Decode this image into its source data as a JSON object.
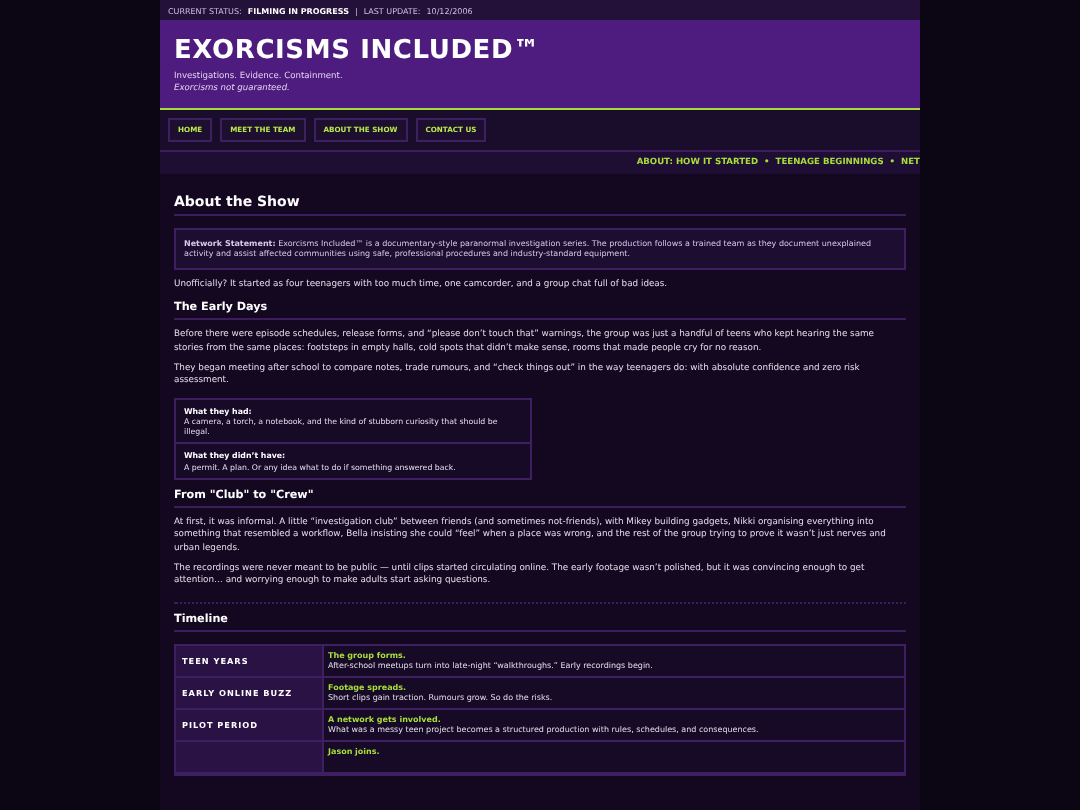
{
  "status_bar": {
    "status_label": "CURRENT STATUS:",
    "status_value": "FILMING IN PROGRESS",
    "separator": "|",
    "update_label": "LAST UPDATE:",
    "update_value": "10/12/2006"
  },
  "header": {
    "title": "EXORCISMS INCLUDED™",
    "tagline": "Investigations. Evidence. Containment.",
    "subtagline": "Exorcisms not guaranteed."
  },
  "nav": [
    {
      "label": "HOME"
    },
    {
      "label": "MEET THE TEAM"
    },
    {
      "label": "ABOUT THE SHOW"
    },
    {
      "label": "CONTACT US"
    }
  ],
  "ticker": "ABOUT: HOW IT STARTED  •  TEENAGE BEGINNINGS  •  NET",
  "content": [
    {
      "kind": "heading",
      "text": "About the Show"
    },
    {
      "kind": "notice",
      "text": "**Network Statement:** Exorcisms Included™ is a documentary-style paranormal investigation series. The production follows a trained team as they document unexplained activity and assist affected communities using safe, professional procedures and industry-standard equipment."
    },
    {
      "kind": "paragraph",
      "text": "Unofficially? It started as four teenagers with too much time, one camcorder, and a group chat full of bad ideas."
    },
    {
      "kind": "subheading",
      "text": "The Early Days"
    },
    {
      "kind": "paragraph",
      "text": "Before there were episode schedules, release forms, and “please don’t touch that” warnings, the group was just a handful of teens who kept hearing the same stories from the same places: footsteps in empty halls, cold spots that didn’t make sense, rooms that made people cry for no reason."
    },
    {
      "kind": "paragraph",
      "text": "They began meeting after school to compare notes, trade rumours, and “check things out” in the way teenagers do: with absolute confidence and zero risk assessment."
    },
    {
      "kind": "facts",
      "items": [
        {
          "title": "What they had:",
          "text": "A camera, a torch, a notebook, and the kind of stubborn curiosity that should be illegal."
        },
        {
          "title": "What they didn’t have:",
          "text": "A permit. A plan. Or any idea what to do if something answered back."
        }
      ]
    },
    {
      "kind": "subheading",
      "text": "From \"Club\" to \"Crew\""
    },
    {
      "kind": "paragraph",
      "text": "At first, it was informal. A little “investigation club” between friends (and sometimes not-friends), with Mikey building gadgets, Nikki organising everything into something that resembled a workflow, Bella insisting she could “feel” when a place was wrong, and the rest of the group trying to prove it wasn’t just nerves and urban legends."
    },
    {
      "kind": "paragraph",
      "text": "The recordings were never meant to be public — until clips started circulating online. The early footage wasn’t polished, but it was convincing enough to get attention… and worrying enough to make adults start asking questions."
    },
    {
      "kind": "divider"
    },
    {
      "kind": "subheading",
      "text": "Timeline"
    },
    {
      "kind": "timeline",
      "rows": [
        {
          "period": "TEEN YEARS",
          "headline": "The group forms.",
          "text": "After-school meetups turn into late-night “walkthroughs.” Early recordings begin."
        },
        {
          "period": "EARLY ONLINE BUZZ",
          "headline": "Footage spreads.",
          "text": "Short clips gain traction. Rumours grow. So do the risks."
        },
        {
          "period": "PILOT PERIOD",
          "headline": "A network gets involved.",
          "text": "What was a messy teen project becomes a structured production with rules, schedules, and consequences."
        },
        {
          "headline": "Jason joins."
        }
      ]
    }
  ]
}
